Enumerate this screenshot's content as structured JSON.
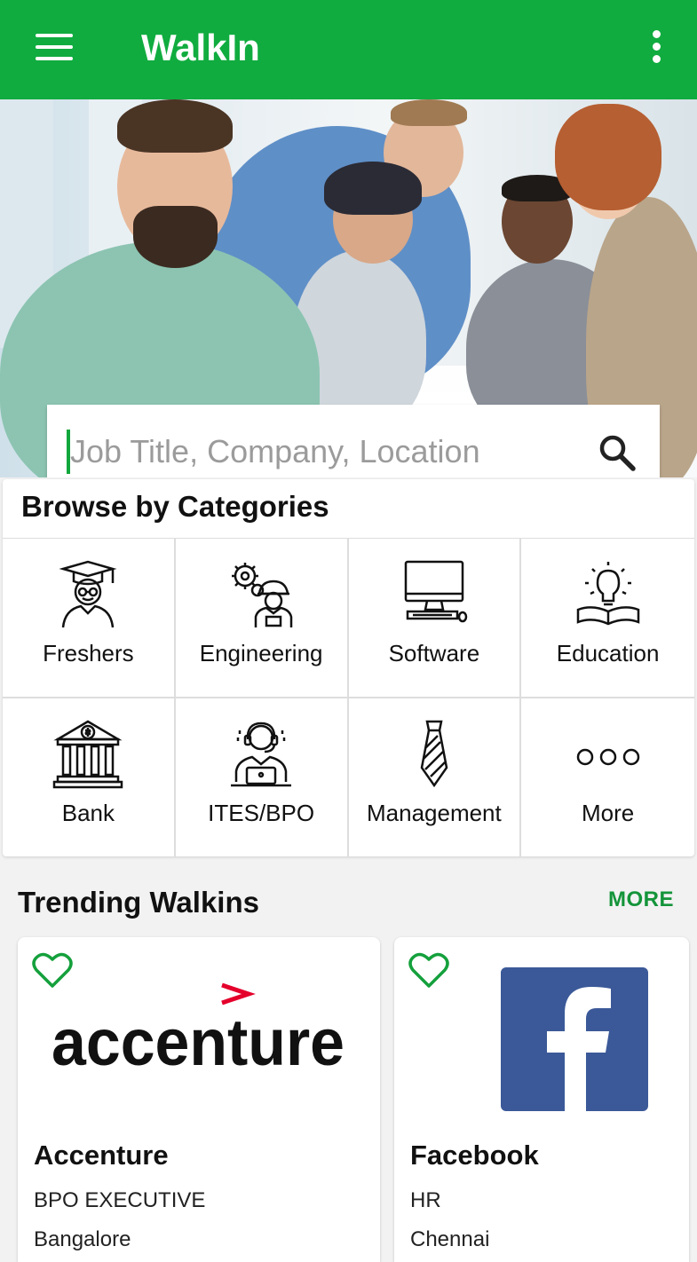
{
  "app": {
    "title": "WalkIn"
  },
  "search": {
    "placeholder": "Job Title, Company, Location"
  },
  "categories": {
    "heading": "Browse by Categories",
    "items": [
      {
        "label": "Freshers",
        "icon": "graduate-icon"
      },
      {
        "label": "Engineering",
        "icon": "engineer-gears-icon"
      },
      {
        "label": "Software",
        "icon": "desktop-computer-icon"
      },
      {
        "label": "Education",
        "icon": "lightbulb-book-icon"
      },
      {
        "label": "Bank",
        "icon": "bank-building-icon"
      },
      {
        "label": "ITES/BPO",
        "icon": "call-center-agent-icon"
      },
      {
        "label": "Management",
        "icon": "necktie-icon"
      },
      {
        "label": "More",
        "icon": "more-dots-icon"
      }
    ]
  },
  "trending": {
    "heading": "Trending Walkins",
    "more_label": "MORE",
    "cards": [
      {
        "company": "Accenture",
        "role": "BPO EXECUTIVE",
        "location": "Bangalore",
        "logo_text": "accenture"
      },
      {
        "company": "Facebook",
        "role": "HR",
        "location": "Chennai",
        "logo_text": "f"
      }
    ]
  },
  "colors": {
    "primary": "#10ac3f",
    "accent_text": "#14943a",
    "facebook_blue": "#3b5998",
    "accenture_red": "#e4002b"
  }
}
